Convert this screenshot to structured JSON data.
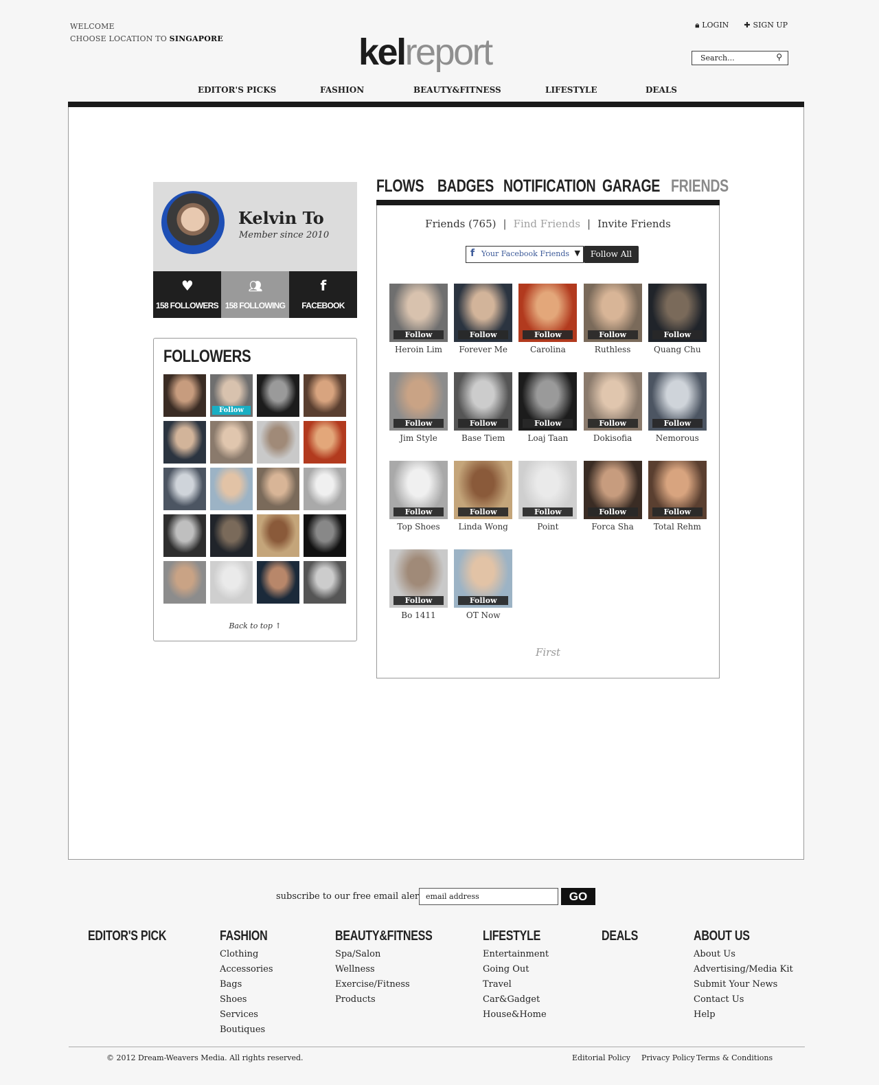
{
  "header": {
    "welcome": "WELCOME",
    "location_prefix": "CHOOSE LOCATION TO",
    "location": "SINGAPORE",
    "logo_a": "kel",
    "logo_b": "report",
    "login": "LOGIN",
    "signup": "SIGN UP",
    "search_placeholder": "Search..."
  },
  "nav": [
    "EDITOR'S PICKS",
    "FASHION",
    "BEAUTY&FITNESS",
    "LIFESTYLE",
    "DEALS"
  ],
  "profile": {
    "name": "Kelvin To",
    "since": "Member since 2010",
    "followers": "158 FOLLOWERS",
    "following": "158 FOLLOWING",
    "facebook": "FACEBOOK"
  },
  "followers_box": {
    "title": "FOLLOWERS",
    "follow_badge": "Follow",
    "back_to_top": "Back to top"
  },
  "tabs": [
    "FLOWS",
    "BADGES",
    "NOTIFICATION",
    "GARAGE",
    "FRIENDS"
  ],
  "friends": {
    "count_label": "Friends (765)",
    "find": "Find Friends",
    "invite": "Invite Friends",
    "fb_button": "Your Facebook Friends",
    "follow_all": "Follow All",
    "follow_label": "Follow",
    "pager": "First",
    "people": [
      "Heroin Lim",
      "Forever Me",
      "Carolina",
      "Ruthless",
      "Quang Chu",
      "Jim Style",
      "Base Tiem",
      "Loaj Taan",
      "Dokisofia",
      "Nemorous",
      "Top Shoes",
      "Linda Wong",
      "Point",
      "Forca Sha",
      "Total Rehm",
      "Bo 1411",
      "OT Now"
    ]
  },
  "footer": {
    "subscribe": "subscribe to our free email alerts",
    "email_placeholder": "email address",
    "go": "GO",
    "cols": [
      {
        "h": "EDITOR'S PICK",
        "items": []
      },
      {
        "h": "FASHION",
        "items": [
          "Clothing",
          "Accessories",
          "Bags",
          "Shoes",
          "Services",
          "Boutiques"
        ]
      },
      {
        "h": "BEAUTY&FITNESS",
        "items": [
          "Spa/Salon",
          "Wellness",
          "Exercise/Fitness",
          "Products"
        ]
      },
      {
        "h": "LIFESTYLE",
        "items": [
          "Entertainment",
          "Going Out",
          "Travel",
          "Car&Gadget",
          "House&Home"
        ]
      },
      {
        "h": "DEALS",
        "items": []
      },
      {
        "h": "ABOUT US",
        "items": [
          "About Us",
          "Advertising/Media Kit",
          "Submit Your News",
          "Contact Us",
          "Help"
        ]
      }
    ],
    "copyright": "© 2012 Dream-Weavers Media. All rights reserved.",
    "legal": [
      "Editorial Policy",
      "Privacy Policy",
      "Terms & Conditions"
    ]
  },
  "colors": {
    "accent_follow": "#19aec3",
    "facebook": "#3b5998",
    "dark": "#1a1a1a"
  }
}
